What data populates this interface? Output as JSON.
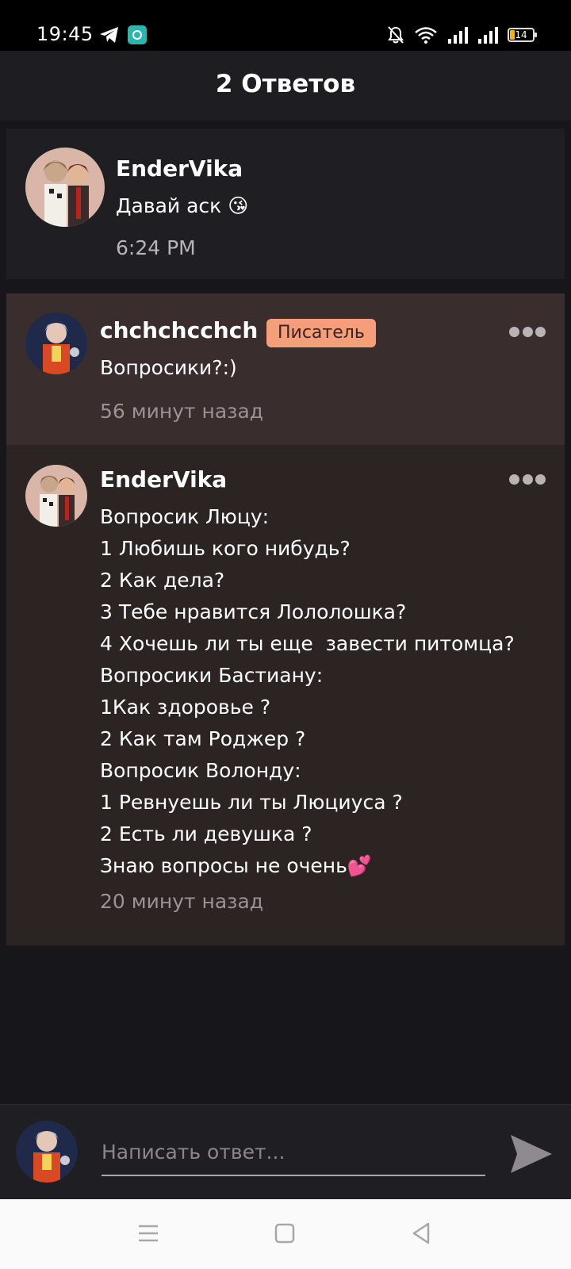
{
  "status_bar": {
    "time": "19:45",
    "battery": "14",
    "icons": [
      "telegram-icon",
      "app-icon",
      "bell-off-icon",
      "wifi-icon",
      "signal-icon",
      "signal-icon",
      "battery-icon"
    ]
  },
  "header": {
    "title": "2 Ответов"
  },
  "parent_comment": {
    "username": "EnderVika",
    "text": "Давай аск 😘",
    "time": "6:24 PM"
  },
  "replies": [
    {
      "username": "chchchcchch",
      "badge": "Писатель",
      "lines": [
        "Вопросики?:)"
      ],
      "time": "56 минут назад"
    },
    {
      "username": "EnderVika",
      "lines": [
        "Вопросик Люцу:",
        "1 Любишь кого нибудь?",
        "2 Как дела?",
        "3 Тебе нравится Лололошка?",
        "4 Хочешь ли ты еще  завести питомца?",
        "Вопросики Бастиану:",
        "1Как здоровье ?",
        "2 Как там Роджер ?",
        "Вопросик Волонду:",
        "1 Ревнуешь ли ты Люциуса ?",
        "2 Есть ли девушка ?",
        "Знаю вопросы не очень💕"
      ],
      "time": "20 минут назад"
    }
  ],
  "reply_bar": {
    "placeholder": "Написать ответ...",
    "send_icon": "send-icon"
  },
  "colors": {
    "background": "#17161a",
    "badge": "#f59e7a",
    "highlight_card": "#392d2d",
    "reply_card": "#2c2423"
  }
}
